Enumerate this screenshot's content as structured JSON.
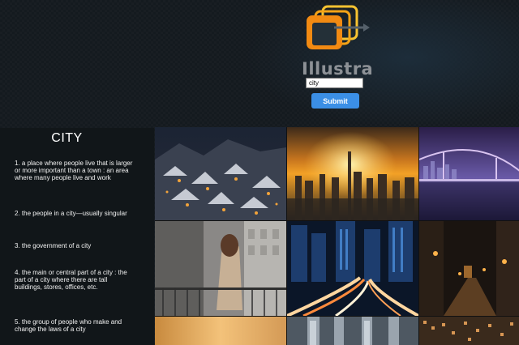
{
  "app": {
    "brand": "Illustra",
    "search": {
      "value": "city",
      "placeholder": ""
    },
    "submit_label": "Submit",
    "colors": {
      "accent": "#3b8fe6",
      "logo_orange": "#f5a316",
      "logo_dark": "#2c3a44"
    }
  },
  "definitions": {
    "word": "CITY",
    "items": [
      "1. a place where people live that is larger or more important than a town : an area where many people live and work",
      "2. the people in a city—usually singular",
      "3. the government of a city",
      "4. the main or central part of a city : the part of a city where there are tall buildings, stores, offices, etc.",
      "5. the group of people who make and change the laws of a city"
    ]
  },
  "gallery": {
    "images": [
      {
        "name": "snowy-town-night-image"
      },
      {
        "name": "sunset-skyline-image"
      },
      {
        "name": "bridge-night-image"
      },
      {
        "name": "woman-balcony-image"
      },
      {
        "name": "light-trails-street-image"
      },
      {
        "name": "night-alley-image"
      },
      {
        "name": "sunset-strip-image"
      },
      {
        "name": "skyscrapers-image"
      },
      {
        "name": "city-lights-image"
      }
    ]
  }
}
